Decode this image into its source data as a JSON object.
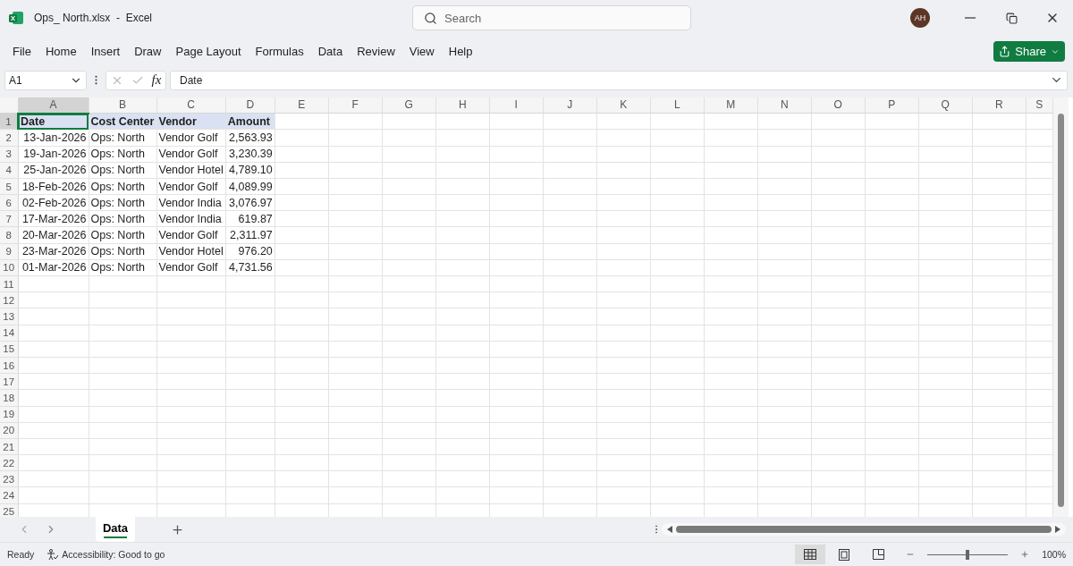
{
  "window": {
    "title": "Ops_ North.xlsx  -  Excel",
    "avatar": "AH"
  },
  "search": {
    "placeholder": "Search"
  },
  "menu": [
    {
      "label": "File"
    },
    {
      "label": "Home"
    },
    {
      "label": "Insert"
    },
    {
      "label": "Draw"
    },
    {
      "label": "Page Layout"
    },
    {
      "label": "Formulas"
    },
    {
      "label": "Data"
    },
    {
      "label": "Review"
    },
    {
      "label": "View"
    },
    {
      "label": "Help"
    }
  ],
  "share": {
    "label": "Share"
  },
  "formula_bar": {
    "name_box": "A1",
    "fx": "fx",
    "value": "Date"
  },
  "columns": [
    {
      "label": "A",
      "kind": "date",
      "selected": true
    },
    {
      "label": "B",
      "kind": "text",
      "selected": false
    },
    {
      "label": "C",
      "kind": "text",
      "selected": false
    },
    {
      "label": "D",
      "kind": "number",
      "selected": false
    },
    {
      "label": "E",
      "kind": "text",
      "selected": false
    },
    {
      "label": "F",
      "kind": "text",
      "selected": false
    },
    {
      "label": "G",
      "kind": "text",
      "selected": false
    },
    {
      "label": "H",
      "kind": "text",
      "selected": false
    },
    {
      "label": "I",
      "kind": "text",
      "selected": false
    },
    {
      "label": "J",
      "kind": "text",
      "selected": false
    },
    {
      "label": "K",
      "kind": "text",
      "selected": false
    },
    {
      "label": "L",
      "kind": "text",
      "selected": false
    },
    {
      "label": "M",
      "kind": "text",
      "selected": false
    },
    {
      "label": "N",
      "kind": "text",
      "selected": false
    },
    {
      "label": "O",
      "kind": "text",
      "selected": false
    },
    {
      "label": "P",
      "kind": "text",
      "selected": false
    },
    {
      "label": "Q",
      "kind": "text",
      "selected": false
    },
    {
      "label": "R",
      "kind": "text",
      "selected": false
    },
    {
      "label": "S",
      "kind": "text",
      "selected": false
    }
  ],
  "rows": [
    {
      "number": "1",
      "kind": "header",
      "selected": true,
      "cells": [
        "Date",
        "Cost Center",
        "Vendor",
        "Amount"
      ]
    },
    {
      "number": "2",
      "kind": "data",
      "selected": false,
      "cells": [
        "13-Jan-2026",
        "Ops: North",
        "Vendor Golf",
        "2,563.93"
      ]
    },
    {
      "number": "3",
      "kind": "data",
      "selected": false,
      "cells": [
        "19-Jan-2026",
        "Ops: North",
        "Vendor Golf",
        "3,230.39"
      ]
    },
    {
      "number": "4",
      "kind": "data",
      "selected": false,
      "cells": [
        "25-Jan-2026",
        "Ops: North",
        "Vendor Hotel",
        "4,789.10"
      ]
    },
    {
      "number": "5",
      "kind": "data",
      "selected": false,
      "cells": [
        "18-Feb-2026",
        "Ops: North",
        "Vendor Golf",
        "4,089.99"
      ]
    },
    {
      "number": "6",
      "kind": "data",
      "selected": false,
      "cells": [
        "02-Feb-2026",
        "Ops: North",
        "Vendor India",
        "3,076.97"
      ]
    },
    {
      "number": "7",
      "kind": "data",
      "selected": false,
      "cells": [
        "17-Mar-2026",
        "Ops: North",
        "Vendor India",
        "619.87"
      ]
    },
    {
      "number": "8",
      "kind": "data",
      "selected": false,
      "cells": [
        "20-Mar-2026",
        "Ops: North",
        "Vendor Golf",
        "2,311.97"
      ]
    },
    {
      "number": "9",
      "kind": "data",
      "selected": false,
      "cells": [
        "23-Mar-2026",
        "Ops: North",
        "Vendor Hotel",
        "976.20"
      ]
    },
    {
      "number": "10",
      "kind": "data",
      "selected": false,
      "cells": [
        "01-Mar-2026",
        "Ops: North",
        "Vendor Golf",
        "4,731.56"
      ]
    },
    {
      "number": "11",
      "kind": "data",
      "selected": false,
      "cells": []
    },
    {
      "number": "12",
      "kind": "data",
      "selected": false,
      "cells": []
    },
    {
      "number": "13",
      "kind": "data",
      "selected": false,
      "cells": []
    },
    {
      "number": "14",
      "kind": "data",
      "selected": false,
      "cells": []
    },
    {
      "number": "15",
      "kind": "data",
      "selected": false,
      "cells": []
    },
    {
      "number": "16",
      "kind": "data",
      "selected": false,
      "cells": []
    },
    {
      "number": "17",
      "kind": "data",
      "selected": false,
      "cells": []
    },
    {
      "number": "18",
      "kind": "data",
      "selected": false,
      "cells": []
    },
    {
      "number": "19",
      "kind": "data",
      "selected": false,
      "cells": []
    },
    {
      "number": "20",
      "kind": "data",
      "selected": false,
      "cells": []
    },
    {
      "number": "21",
      "kind": "data",
      "selected": false,
      "cells": []
    },
    {
      "number": "22",
      "kind": "data",
      "selected": false,
      "cells": []
    },
    {
      "number": "23",
      "kind": "data",
      "selected": false,
      "cells": []
    },
    {
      "number": "24",
      "kind": "data",
      "selected": false,
      "cells": []
    },
    {
      "number": "25",
      "kind": "data",
      "selected": false,
      "cells": []
    }
  ],
  "sheet_tabs": [
    {
      "label": "Data",
      "selected": true
    }
  ],
  "status_bar": {
    "ready": "Ready",
    "accessibility": "Accessibility: Good to go",
    "views": [
      {
        "kind": "normal",
        "selected": true
      },
      {
        "kind": "page-layout",
        "selected": false
      },
      {
        "kind": "page-break",
        "selected": false
      }
    ],
    "zoom": {
      "level": 0.5,
      "reading": "100%"
    }
  }
}
